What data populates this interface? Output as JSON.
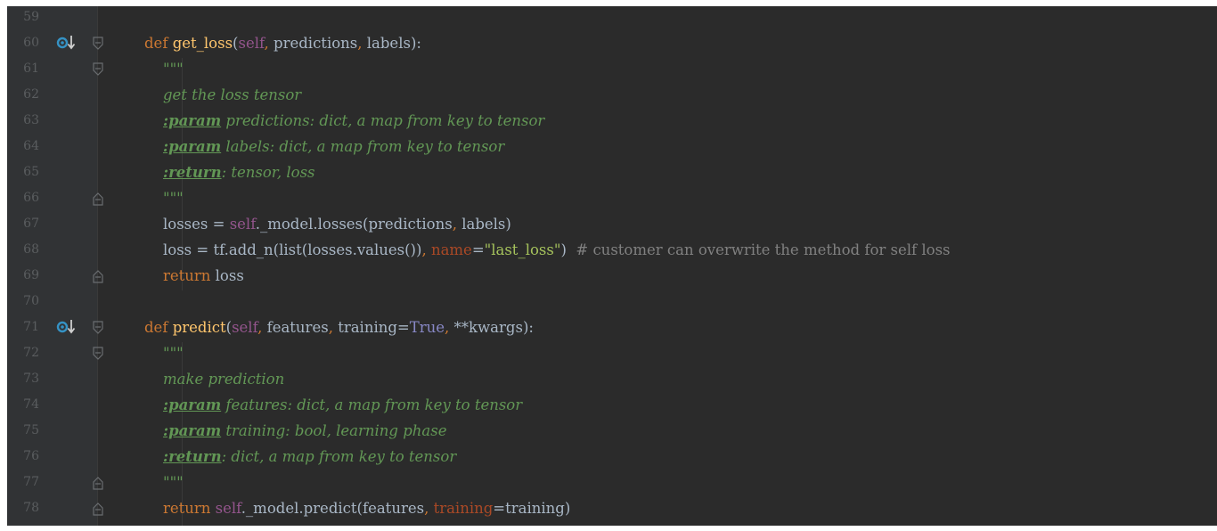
{
  "editor": {
    "lines": [
      {
        "num": "59",
        "tokens": []
      },
      {
        "num": "60",
        "marker": true,
        "fold": "open",
        "tokens": [
          {
            "t": "def ",
            "c": "kw"
          },
          {
            "t": "get_loss",
            "c": "fn"
          },
          {
            "t": "(",
            "c": ""
          },
          {
            "t": "self",
            "c": "slf"
          },
          {
            "t": ", ",
            "c": "punc"
          },
          {
            "t": "predictions",
            "c": ""
          },
          {
            "t": ", ",
            "c": "punc"
          },
          {
            "t": "labels",
            "c": ""
          },
          {
            "t": "):",
            "c": ""
          }
        ]
      },
      {
        "num": "61",
        "fold": "open",
        "tokens": [
          {
            "t": "    \"\"\"",
            "c": "doc"
          }
        ]
      },
      {
        "num": "62",
        "tokens": [
          {
            "t": "    get the loss tensor",
            "c": "doc"
          }
        ]
      },
      {
        "num": "63",
        "tokens": [
          {
            "t": "    ",
            "c": ""
          },
          {
            "t": ":param",
            "c": "doctag"
          },
          {
            "t": " predictions: dict, a map from key to tensor",
            "c": "doc"
          }
        ]
      },
      {
        "num": "64",
        "tokens": [
          {
            "t": "    ",
            "c": ""
          },
          {
            "t": ":param",
            "c": "doctag"
          },
          {
            "t": " labels: dict, a map from key to tensor",
            "c": "doc"
          }
        ]
      },
      {
        "num": "65",
        "tokens": [
          {
            "t": "    ",
            "c": ""
          },
          {
            "t": ":return",
            "c": "doctag"
          },
          {
            "t": ": tensor, loss",
            "c": "doc"
          }
        ]
      },
      {
        "num": "66",
        "fold": "close",
        "tokens": [
          {
            "t": "    \"\"\"",
            "c": "doc"
          }
        ]
      },
      {
        "num": "67",
        "tokens": [
          {
            "t": "    losses = ",
            "c": ""
          },
          {
            "t": "self",
            "c": "slf"
          },
          {
            "t": "._model.losses(predictions",
            "c": ""
          },
          {
            "t": ", ",
            "c": "punc"
          },
          {
            "t": "labels)",
            "c": ""
          }
        ]
      },
      {
        "num": "68",
        "tokens": [
          {
            "t": "    loss = tf.add_n(list(losses.values())",
            "c": ""
          },
          {
            "t": ", ",
            "c": "punc"
          },
          {
            "t": "name",
            "c": "prm"
          },
          {
            "t": "=",
            "c": ""
          },
          {
            "t": "\"last_loss\"",
            "c": "str"
          },
          {
            "t": ")  ",
            "c": ""
          },
          {
            "t": "# customer can overwrite the method for self loss",
            "c": "cmt"
          }
        ]
      },
      {
        "num": "69",
        "fold": "close",
        "tokens": [
          {
            "t": "    ",
            "c": ""
          },
          {
            "t": "return ",
            "c": "kw"
          },
          {
            "t": "loss",
            "c": ""
          }
        ]
      },
      {
        "num": "70",
        "tokens": []
      },
      {
        "num": "71",
        "marker": true,
        "fold": "open",
        "tokens": [
          {
            "t": "def ",
            "c": "kw"
          },
          {
            "t": "predict",
            "c": "fn"
          },
          {
            "t": "(",
            "c": ""
          },
          {
            "t": "self",
            "c": "slf"
          },
          {
            "t": ", ",
            "c": "punc"
          },
          {
            "t": "features",
            "c": ""
          },
          {
            "t": ", ",
            "c": "punc"
          },
          {
            "t": "training=",
            "c": ""
          },
          {
            "t": "True",
            "c": "bool"
          },
          {
            "t": ", ",
            "c": "punc"
          },
          {
            "t": "**kwargs",
            "c": ""
          },
          {
            "t": "):",
            "c": ""
          }
        ]
      },
      {
        "num": "72",
        "fold": "open",
        "tokens": [
          {
            "t": "    \"\"\"",
            "c": "doc"
          }
        ]
      },
      {
        "num": "73",
        "tokens": [
          {
            "t": "    make prediction",
            "c": "doc"
          }
        ]
      },
      {
        "num": "74",
        "tokens": [
          {
            "t": "    ",
            "c": ""
          },
          {
            "t": ":param",
            "c": "doctag"
          },
          {
            "t": " features: dict, a map from key to tensor",
            "c": "doc"
          }
        ]
      },
      {
        "num": "75",
        "tokens": [
          {
            "t": "    ",
            "c": ""
          },
          {
            "t": ":param",
            "c": "doctag"
          },
          {
            "t": " training: bool, learning phase",
            "c": "doc"
          }
        ]
      },
      {
        "num": "76",
        "tokens": [
          {
            "t": "    ",
            "c": ""
          },
          {
            "t": ":return",
            "c": "doctag"
          },
          {
            "t": ": dict, a map from key to tensor",
            "c": "doc"
          }
        ]
      },
      {
        "num": "77",
        "fold": "close",
        "tokens": [
          {
            "t": "    \"\"\"",
            "c": "doc"
          }
        ]
      },
      {
        "num": "78",
        "fold": "close",
        "tokens": [
          {
            "t": "    ",
            "c": ""
          },
          {
            "t": "return ",
            "c": "kw"
          },
          {
            "t": "self",
            "c": "slf"
          },
          {
            "t": "._model.predict(features",
            "c": ""
          },
          {
            "t": ", ",
            "c": "punc"
          },
          {
            "t": "training",
            "c": "prm"
          },
          {
            "t": "=training)",
            "c": ""
          }
        ]
      }
    ],
    "colors": {
      "background": "#2b2b2b",
      "gutter": "#313335",
      "keyword": "#cc7832",
      "function": "#ffc66d",
      "self": "#94558d",
      "string": "#a5c25c",
      "docstring": "#629755",
      "comment": "#808080",
      "marker": "#3592c4"
    },
    "icons": {
      "marker": "override-method-icon",
      "fold_open": "fold-open-icon",
      "fold_close": "fold-close-icon"
    }
  }
}
